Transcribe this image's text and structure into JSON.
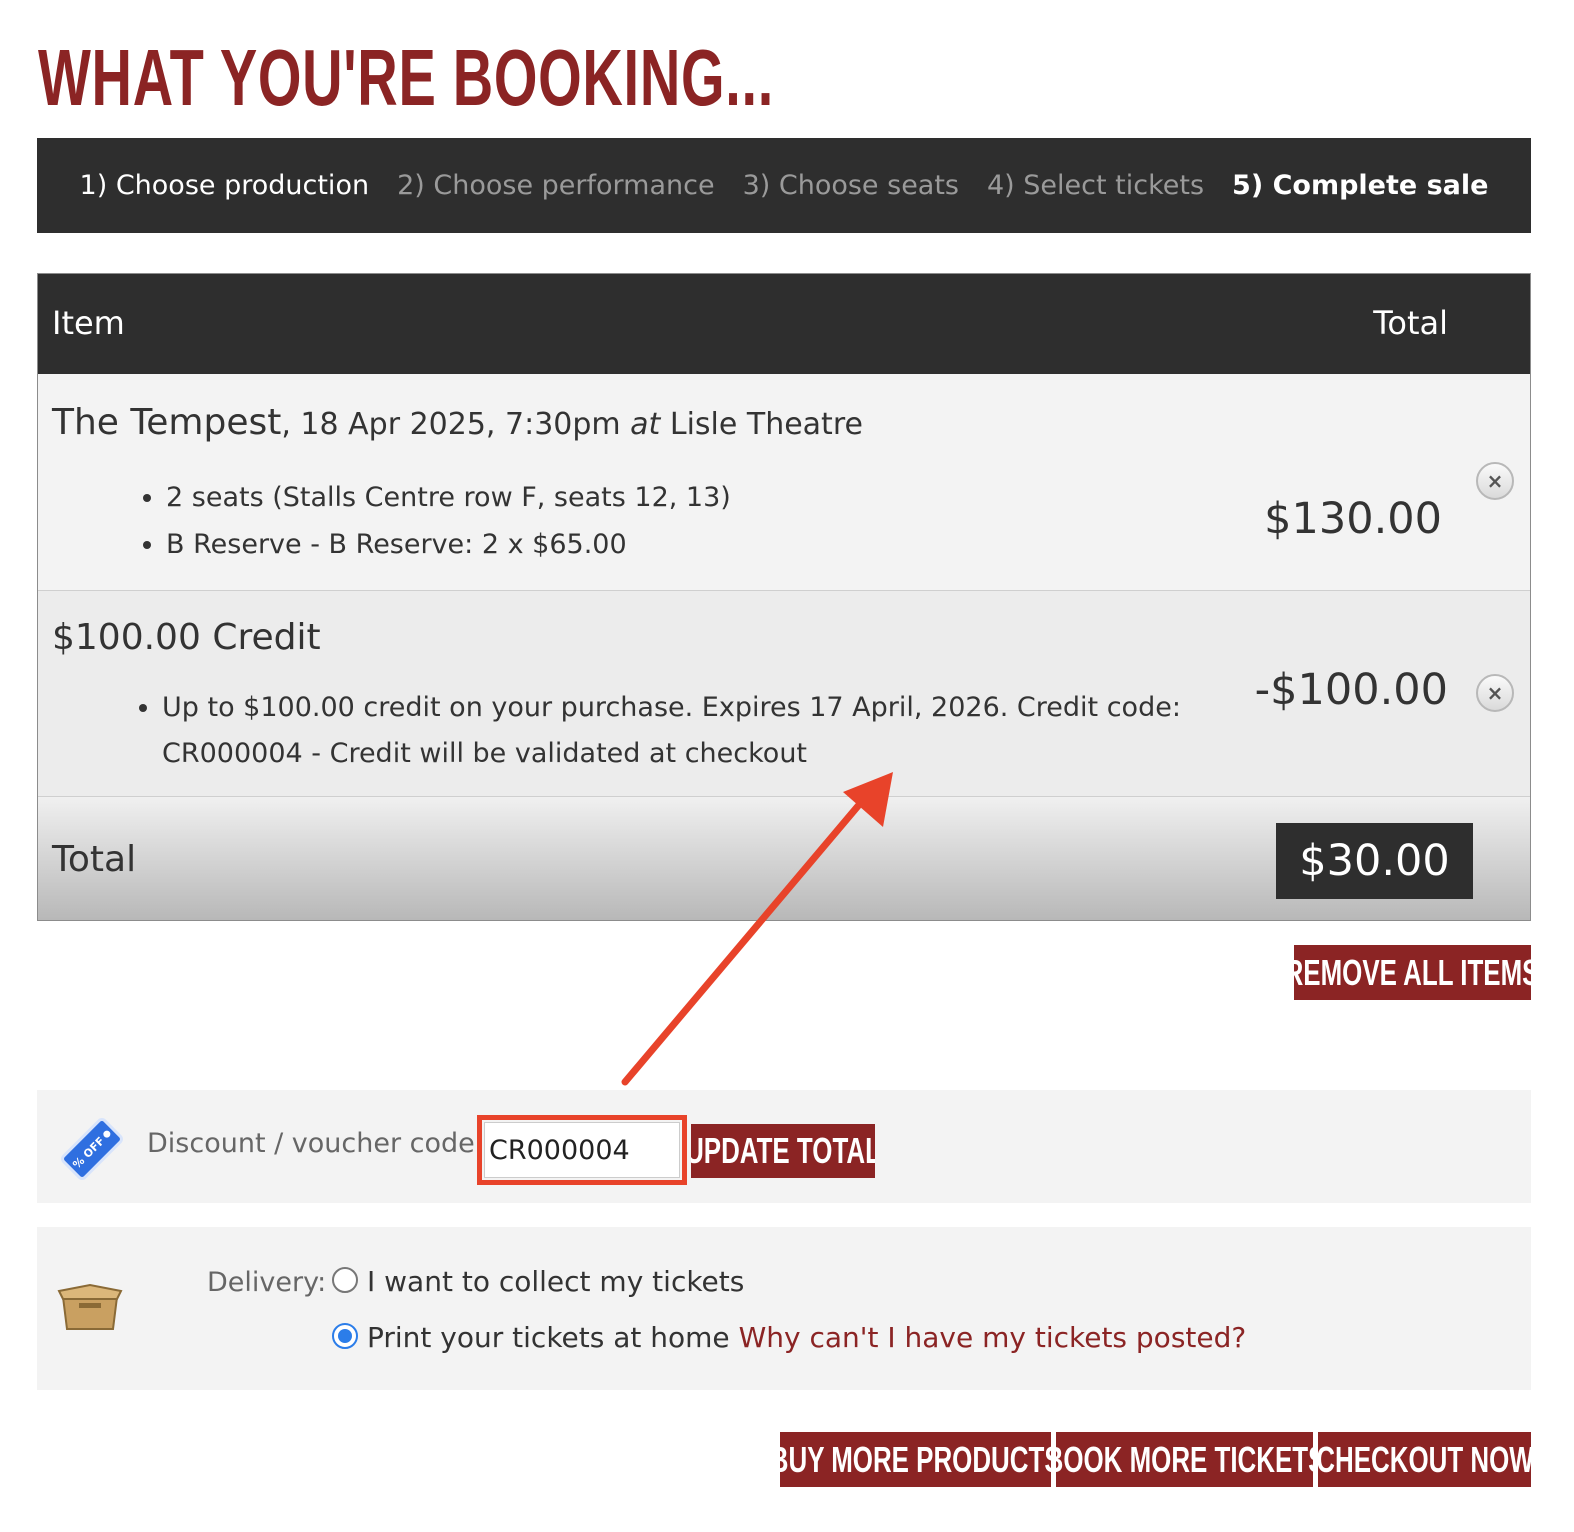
{
  "page": {
    "title": "WHAT YOU'RE BOOKING..."
  },
  "steps": [
    {
      "label": "1) Choose production",
      "state": "done"
    },
    {
      "label": "2) Choose performance",
      "state": "pending"
    },
    {
      "label": "3) Choose seats",
      "state": "pending"
    },
    {
      "label": "4) Select tickets",
      "state": "pending"
    },
    {
      "label": "5) Complete sale",
      "state": "current"
    }
  ],
  "cart": {
    "headers": {
      "item": "Item",
      "total": "Total"
    },
    "items": [
      {
        "production": "The Tempest",
        "datetime": ", 18 Apr 2025, 7:30pm ",
        "at": "at",
        "venue": "Lisle Theatre",
        "details": [
          "2 seats (Stalls Centre row F, seats 12, 13)",
          "B Reserve - B Reserve: 2 x $65.00"
        ],
        "price": "$130.00",
        "remove_symbol": "×"
      },
      {
        "title": "$100.00 Credit",
        "details": [
          "Up to $100.00 credit on your purchase. Expires 17 April, 2026. Credit code: CR000004 - Credit will be validated at checkout"
        ],
        "price": "-$100.00",
        "remove_symbol": "×"
      }
    ],
    "total_label": "Total",
    "total_value": "$30.00"
  },
  "buttons": {
    "remove_all": "REMOVE ALL ITEMS",
    "update_total": "UPDATE TOTAL",
    "buy_more_products": "BUY MORE PRODUCTS",
    "book_more_tickets": "BOOK MORE TICKETS",
    "checkout_now": "CHECKOUT NOW"
  },
  "voucher": {
    "label": "Discount / voucher code:",
    "value": "CR000004",
    "badge_text": "% OFF"
  },
  "delivery": {
    "label": "Delivery:",
    "options": [
      {
        "label": "I want to collect my tickets",
        "selected": false
      },
      {
        "label": "Print your tickets at home",
        "selected": true
      }
    ],
    "posted_link": "Why can't I have my tickets posted?"
  },
  "colors": {
    "brand": "#8b2424",
    "dark": "#2e2e2e",
    "annotation": "#e8432a",
    "radio_selected": "#2b7de9"
  },
  "icons": {
    "voucher": "discount-tag-icon",
    "delivery": "box-icon",
    "remove": "close-circle-icon"
  }
}
